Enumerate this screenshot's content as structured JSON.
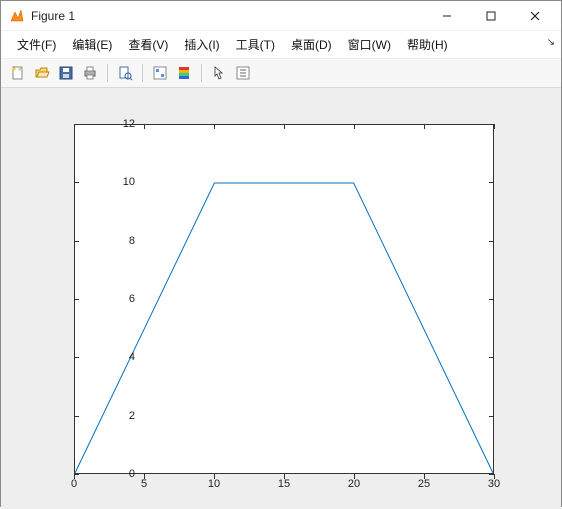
{
  "window": {
    "title": "Figure 1"
  },
  "menu": {
    "file": "文件(F)",
    "edit": "编辑(E)",
    "view": "查看(V)",
    "insert": "插入(I)",
    "tools": "工具(T)",
    "desktop": "桌面(D)",
    "window": "窗口(W)",
    "help": "帮助(H)"
  },
  "toolbar_icons": {
    "new": "new-figure-icon",
    "open": "open-icon",
    "save": "save-icon",
    "print": "print-icon",
    "print_preview": "print-preview-icon",
    "datacursor": "data-cursor-icon",
    "colorbar": "colorbar-icon",
    "legend": "legend-icon",
    "arrow": "arrow-icon",
    "insert": "insert-icon"
  },
  "chart_data": {
    "type": "line",
    "x": [
      0,
      10,
      20,
      30
    ],
    "y": [
      0,
      10,
      10,
      0
    ],
    "xlim": [
      0,
      30
    ],
    "ylim": [
      0,
      12
    ],
    "xticks": [
      0,
      5,
      10,
      15,
      20,
      25,
      30
    ],
    "yticks": [
      0,
      2,
      4,
      6,
      8,
      10,
      12
    ],
    "line_color": "#0072BD",
    "title": "",
    "xlabel": "",
    "ylabel": ""
  }
}
